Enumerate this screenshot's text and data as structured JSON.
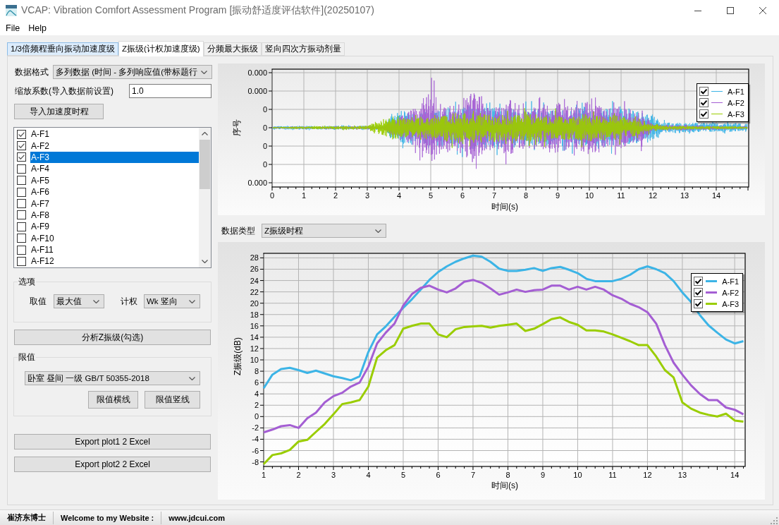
{
  "window": {
    "title": "VCAP: Vibration Comfort Assessment Program [振动舒适度评估软件](20250107)"
  },
  "menu": [
    {
      "label": "File"
    },
    {
      "label": "Help"
    }
  ],
  "tabs": [
    {
      "label": "1/3倍频程垂向振动加速度级",
      "selected": false,
      "hovered": true
    },
    {
      "label": "Z振级(计权加速度级)",
      "selected": true,
      "hovered": false
    },
    {
      "label": "分频最大振级",
      "selected": false,
      "hovered": false
    },
    {
      "label": "竖向四次方振动剂量",
      "selected": false,
      "hovered": false
    }
  ],
  "left_panel": {
    "data_format": {
      "label": "数据格式",
      "value": "多列数据 (时间 - 多列响应值(带标题行"
    },
    "scale_factor": {
      "label": "缩放系数(导入数据前设置)",
      "value": "1.0"
    },
    "import_button": "导入加速度时程",
    "channels": [
      {
        "label": "A-F1",
        "checked": true,
        "selected": false
      },
      {
        "label": "A-F2",
        "checked": true,
        "selected": false
      },
      {
        "label": "A-F3",
        "checked": true,
        "selected": true
      },
      {
        "label": "A-F4",
        "checked": false,
        "selected": false
      },
      {
        "label": "A-F5",
        "checked": false,
        "selected": false
      },
      {
        "label": "A-F6",
        "checked": false,
        "selected": false
      },
      {
        "label": "A-F7",
        "checked": false,
        "selected": false
      },
      {
        "label": "A-F8",
        "checked": false,
        "selected": false
      },
      {
        "label": "A-F9",
        "checked": false,
        "selected": false
      },
      {
        "label": "A-F10",
        "checked": false,
        "selected": false
      },
      {
        "label": "A-F11",
        "checked": false,
        "selected": false
      },
      {
        "label": "A-F12",
        "checked": false,
        "selected": false
      }
    ],
    "options_group": {
      "title": "选项",
      "value_label": "取值",
      "value_select": "最大值",
      "weight_label": "计权",
      "weight_select": "Wk 竖向"
    },
    "analyze_button": "分析Z振级(勾选)",
    "limit_group": {
      "title": "限值",
      "standard_select": "卧室 昼间 一级 GB/T 50355-2018",
      "buttons": [
        "限值横线",
        "限值竖线"
      ]
    },
    "export_buttons": [
      "Export plot1 2 Excel",
      "Export plot2 2 Excel"
    ]
  },
  "waveform_chart": {
    "ylabel": "序号",
    "xlabel": "时间(s)",
    "y_tick_labels": [
      "0.000",
      "0.000",
      "0",
      "0",
      "0",
      "0",
      "0.000"
    ],
    "x_tick_labels": [
      "0",
      "1",
      "2",
      "3",
      "4",
      "5",
      "6",
      "7",
      "8",
      "9",
      "10",
      "11",
      "12",
      "13",
      "14"
    ],
    "legend": [
      {
        "label": "A-F1",
        "checked": true,
        "color": "#3cb4e6"
      },
      {
        "label": "A-F2",
        "checked": true,
        "color": "#a45ed3"
      },
      {
        "label": "A-F3",
        "checked": true,
        "color": "#9acd00"
      }
    ]
  },
  "level_chart_panel": {
    "type_label": "数据类型",
    "type_select": "Z振级时程",
    "legend_entries": [
      {
        "checked": true
      },
      {
        "checked": true
      },
      {
        "checked": true
      }
    ],
    "chart_data": {
      "type": "line",
      "xlabel": "时间(s)",
      "ylabel": "Z振级(dB)",
      "grid": true,
      "legend": "upper right",
      "x": [
        1,
        1.25,
        1.5,
        1.75,
        2,
        2.25,
        2.5,
        2.75,
        3,
        3.25,
        3.5,
        3.75,
        4,
        4.25,
        4.5,
        4.75,
        5,
        5.25,
        5.5,
        5.75,
        6,
        6.25,
        6.5,
        6.75,
        7,
        7.25,
        7.5,
        7.75,
        8,
        8.25,
        8.5,
        8.75,
        9,
        9.25,
        9.5,
        9.75,
        10,
        10.25,
        10.5,
        10.75,
        11,
        11.25,
        11.5,
        11.75,
        12,
        12.25,
        12.5,
        12.75,
        13,
        13.25,
        13.5,
        13.75,
        14,
        14.25,
        14.5,
        14.75
      ],
      "series": [
        {
          "name": "A-F1",
          "color": "#3cb4e6",
          "values": [
            5.0,
            7.4,
            8.4,
            8.6,
            8.2,
            7.7,
            8.1,
            7.6,
            7.1,
            6.8,
            6.4,
            7.1,
            11.4,
            14.5,
            15.9,
            17.6,
            19.2,
            20.7,
            22.4,
            24.1,
            25.5,
            26.5,
            27.3,
            27.9,
            28.4,
            28.2,
            27.3,
            26.1,
            25.7,
            25.7,
            25.9,
            26.2,
            25.7,
            26.2,
            26.4,
            25.9,
            25.3,
            24.3,
            23.9,
            23.9,
            23.9,
            24.3,
            25.0,
            26.0,
            26.5,
            26.0,
            25.3,
            23.9,
            21.9,
            20.2,
            17.9,
            16.1,
            14.8,
            13.6,
            12.9,
            13.3
          ]
        },
        {
          "name": "A-F2",
          "color": "#a45ed3",
          "values": [
            -2.8,
            -2.3,
            -1.7,
            -1.5,
            -2.0,
            -0.3,
            0.7,
            2.5,
            3.6,
            4.2,
            5.3,
            6.0,
            8.8,
            12.9,
            14.8,
            16.4,
            19.6,
            21.6,
            22.7,
            23.1,
            22.4,
            21.9,
            22.6,
            23.8,
            24.1,
            23.6,
            22.6,
            21.5,
            21.9,
            22.4,
            22.0,
            22.3,
            22.4,
            23.1,
            23.1,
            22.4,
            22.9,
            22.4,
            22.9,
            22.4,
            21.4,
            20.8,
            19.9,
            19.3,
            18.4,
            16.4,
            12.6,
            9.5,
            7.4,
            5.5,
            4.0,
            2.9,
            2.9,
            1.6,
            1.2,
            0.4
          ]
        },
        {
          "name": "A-F3",
          "color": "#9acd00",
          "values": [
            -8.4,
            -6.8,
            -6.5,
            -5.9,
            -4.4,
            -4.1,
            -2.7,
            -1.3,
            0.4,
            2.2,
            2.5,
            2.9,
            5.3,
            10.4,
            11.7,
            12.6,
            15.5,
            16.0,
            16.4,
            16.4,
            14.5,
            14.0,
            15.4,
            15.8,
            15.9,
            16.0,
            15.7,
            16.0,
            16.2,
            16.4,
            15.1,
            15.5,
            16.3,
            17.2,
            17.5,
            16.7,
            16.2,
            15.2,
            15.2,
            15.0,
            14.5,
            13.9,
            13.3,
            12.6,
            12.6,
            10.6,
            8.2,
            6.9,
            2.5,
            1.4,
            0.7,
            0.3,
            0.0,
            0.5,
            -0.7,
            -0.9
          ]
        }
      ],
      "xlim": [
        1,
        14.8
      ],
      "ylim": [
        -8.8,
        28.8
      ],
      "xticks": [
        1,
        2,
        3,
        4,
        5,
        6,
        7,
        8,
        9,
        10,
        11,
        12,
        13,
        {
          "value": 14.5,
          "label": "14"
        }
      ],
      "yticks": [
        -8,
        -6,
        -4,
        -2,
        0,
        2,
        4,
        6,
        8,
        10,
        12,
        14,
        16,
        18,
        20,
        22,
        24,
        26,
        28
      ]
    }
  },
  "status_bar": [
    "崔济东博士",
    "Welcome to my Website :",
    "www.jdcui.com"
  ]
}
